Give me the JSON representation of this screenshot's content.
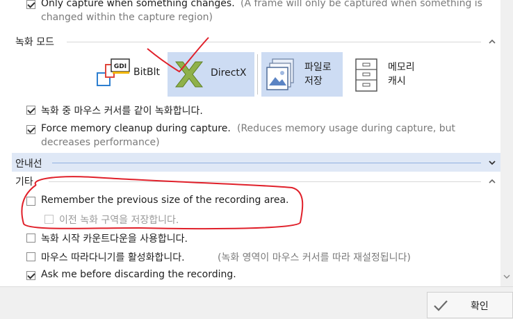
{
  "top_option": {
    "label": "Only capture when something changes.",
    "hint_line1": "(A frame will only be captured when something is",
    "hint_line2": "changed within the capture region)",
    "checked": true
  },
  "recording_mode": {
    "title": "녹화 모드",
    "modes": [
      {
        "id": "bitblt",
        "label": "BitBlt",
        "icon": "gdi-icon",
        "selected": false
      },
      {
        "id": "directx",
        "label": "DirectX",
        "icon": "directx-icon",
        "selected": true
      },
      {
        "id": "file",
        "label_line1": "파일로",
        "label_line2": "저장",
        "icon": "save-to-file-icon",
        "selected": true
      },
      {
        "id": "memory",
        "label_line1": "메모리",
        "label_line2": "캐시",
        "icon": "memory-cache-icon",
        "selected": false
      }
    ]
  },
  "options_mid": [
    {
      "label": "녹화 중 마우스 커서를 같이 녹화합니다.",
      "checked": true
    },
    {
      "label": "Force memory cleanup during capture.",
      "hint_line1": "(Reduces memory usage during capture, but",
      "hint_line2": "decreases performance)",
      "checked": true
    }
  ],
  "guidelines": {
    "title": "안내선"
  },
  "other": {
    "title": "기타",
    "options": [
      {
        "label": "Remember the previous size of the recording area.",
        "checked": false
      },
      {
        "label": "이전 녹화 구역을 저장합니다.",
        "checked": false,
        "disabled": true
      },
      {
        "label": "녹화 시작 카운트다운을 사용합니다.",
        "checked": false
      },
      {
        "label": "마우스 따라다니기를 활성화합니다.",
        "hint": "(녹화 영역이 마우스 커서를 따라 재설정됩니다)",
        "checked": false
      },
      {
        "label": "Ask me before discarding the recording.",
        "checked": true
      }
    ]
  },
  "footer": {
    "ok_label": "확인"
  },
  "colors": {
    "selected_bg": "#cddcf3",
    "annotation_red": "#e0202a",
    "guideline_bar": "#dfe8f6",
    "footer_bg": "#f0f0f0"
  }
}
